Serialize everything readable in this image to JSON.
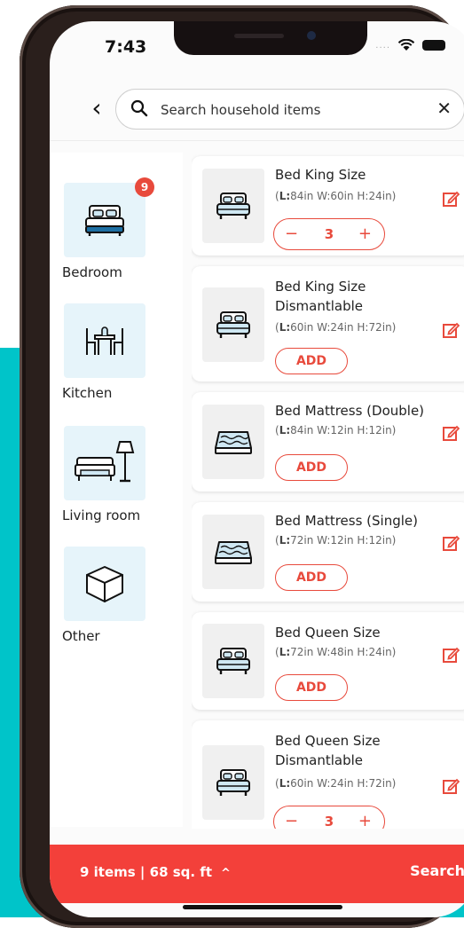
{
  "status_bar": {
    "time": "7:43"
  },
  "search": {
    "placeholder": "Search household items"
  },
  "categories": [
    {
      "label": "Bedroom",
      "icon": "bed-icon",
      "badge": "9"
    },
    {
      "label": "Kitchen",
      "icon": "dining-table-icon"
    },
    {
      "label": "Living room",
      "icon": "sofa-lamp-icon"
    },
    {
      "label": "Other",
      "icon": "box-icon"
    }
  ],
  "items": [
    {
      "name": "Bed King Size",
      "dims_l": "L:",
      "dims_rest": "84in W:60in H:24in)",
      "quantity": "3",
      "icon": "bed-icon"
    },
    {
      "name": "Bed King Size Dismantlable",
      "dims_l": "L:",
      "dims_rest": "60in W:24in H:72in)",
      "action": "ADD",
      "icon": "bed-icon"
    },
    {
      "name": "Bed Mattress (Double)",
      "dims_l": "L:",
      "dims_rest": "84in W:12in H:12in)",
      "action": "ADD",
      "icon": "mattress-icon"
    },
    {
      "name": "Bed Mattress (Single)",
      "dims_l": "L:",
      "dims_rest": "72in W:12in H:12in)",
      "action": "ADD",
      "icon": "mattress-icon"
    },
    {
      "name": "Bed Queen Size",
      "dims_l": "L:",
      "dims_rest": "72in W:48in H:24in)",
      "action": "ADD",
      "icon": "bed-icon"
    },
    {
      "name": "Bed Queen Size Dismantlable",
      "dims_l": "L:",
      "dims_rest": "60in W:24in H:72in)",
      "quantity": "3",
      "icon": "bed-icon"
    }
  ],
  "stepper": {
    "minus": "−",
    "plus": "+"
  },
  "footer": {
    "summary": "9 items | 68 sq. ft",
    "caret": "^",
    "search_label": "Search"
  },
  "colors": {
    "accent": "#e84a3c",
    "bar": "#f3403a",
    "tile": "#e6f4fa",
    "teal": "#00c4c9"
  }
}
